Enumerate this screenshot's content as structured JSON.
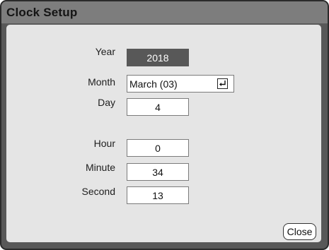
{
  "dialog": {
    "title": "Clock Setup"
  },
  "fields": {
    "year": {
      "label": "Year",
      "value": "2018",
      "selected": true
    },
    "month": {
      "label": "Month",
      "value": "March (03)"
    },
    "day": {
      "label": "Day",
      "value": "4"
    },
    "hour": {
      "label": "Hour",
      "value": "0"
    },
    "minute": {
      "label": "Minute",
      "value": "34"
    },
    "second": {
      "label": "Second",
      "value": "13"
    }
  },
  "icons": {
    "month_dropdown": "enter-return-icon"
  },
  "buttons": {
    "close_label": "Close"
  },
  "colors": {
    "frame": "#585858",
    "titlebar": "#7d7d7d",
    "panel": "#e5e5e5",
    "selected_field": "#585858"
  }
}
